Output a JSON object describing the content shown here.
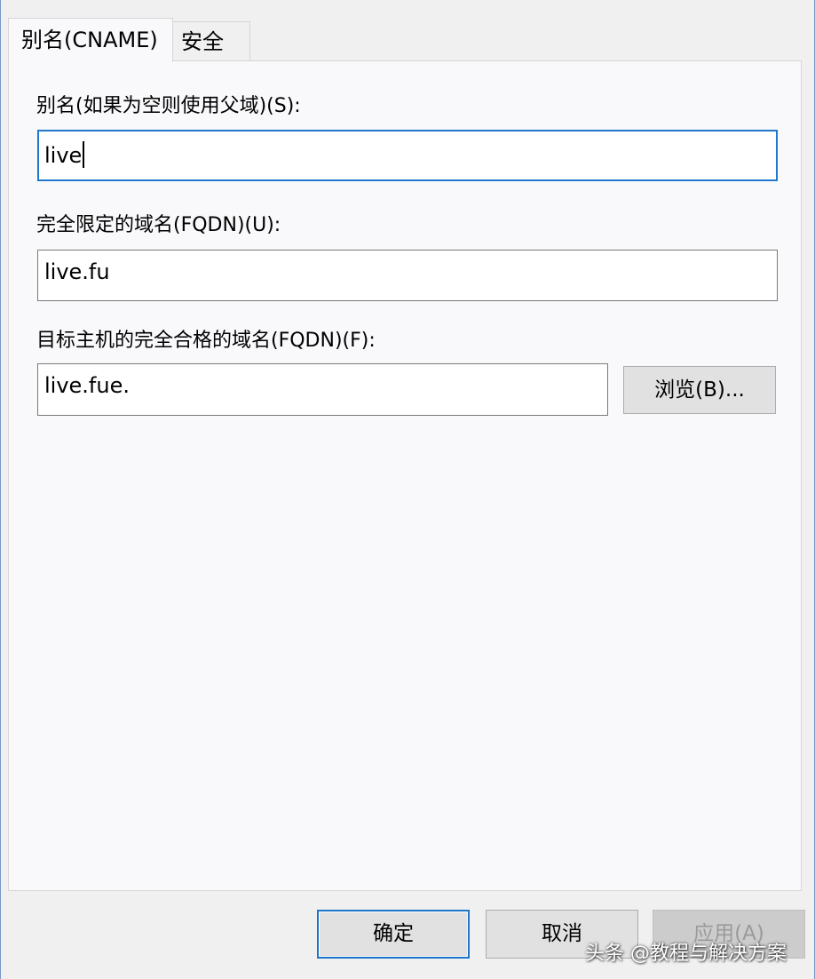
{
  "tabs": [
    {
      "label": "别名(CNAME)",
      "active": true
    },
    {
      "label": "安全",
      "active": false
    }
  ],
  "alias": {
    "label": "别名(如果为空则使用父域)(S):",
    "value": "live"
  },
  "fqdn": {
    "label": "完全限定的域名(FQDN)(U):",
    "value": "live.fu"
  },
  "target": {
    "label": "目标主机的完全合格的域名(FQDN)(F):",
    "value": "live.fue.",
    "browse_label": "浏览(B)..."
  },
  "footer": {
    "ok_label": "确定",
    "cancel_label": "取消",
    "apply_label": "应用(A)"
  },
  "watermark": "头条 @教程与解决方案",
  "colors": {
    "focus_accent": "#1f78c9",
    "panel_bg": "#f9f9fb",
    "dialog_bg": "#f0f0f0"
  }
}
